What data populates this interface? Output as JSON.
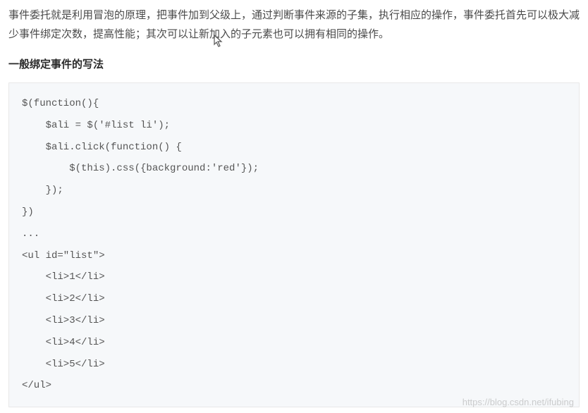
{
  "paragraph": "事件委托就是利用冒泡的原理，把事件加到父级上，通过判断事件来源的子集，执行相应的操作，事件委托首先可以极大减少事件绑定次数，提高性能；其次可以让新加入的子元素也可以拥有相同的操作。",
  "heading": "一般绑定事件的写法",
  "code": "$(function(){\n    $ali = $('#list li');\n    $ali.click(function() {\n        $(this).css({background:'red'});\n    });\n})\n...\n<ul id=\"list\">\n    <li>1</li>\n    <li>2</li>\n    <li>3</li>\n    <li>4</li>\n    <li>5</li>\n</ul>",
  "watermark": "https://blog.csdn.net/ifubing"
}
